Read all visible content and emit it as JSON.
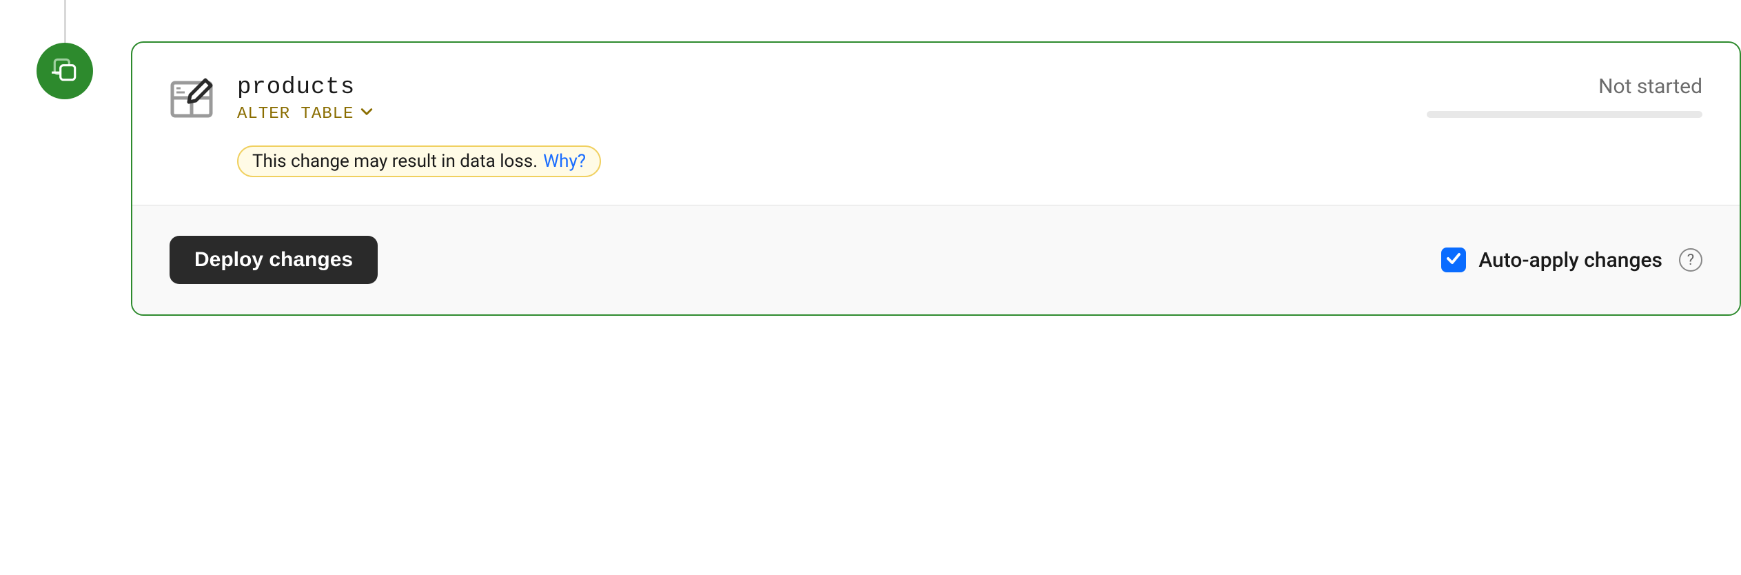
{
  "item": {
    "title": "products",
    "operation": "ALTER TABLE",
    "status": "Not started"
  },
  "warning": {
    "message": "This change may result in data loss. ",
    "link": "Why?"
  },
  "footer": {
    "deploy_label": "Deploy changes",
    "auto_apply_label": "Auto-apply changes",
    "auto_apply_checked": true
  }
}
